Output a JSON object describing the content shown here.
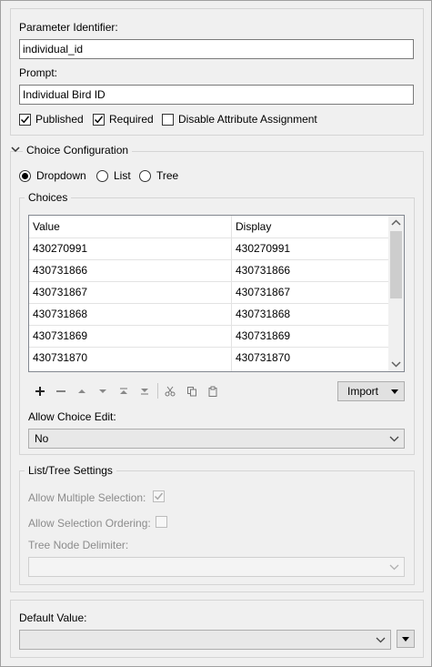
{
  "parameter_identifier": {
    "label": "Parameter Identifier:",
    "value": "individual_id"
  },
  "prompt": {
    "label": "Prompt:",
    "value": "Individual Bird ID"
  },
  "flags": {
    "published": {
      "label": "Published",
      "checked": true
    },
    "required": {
      "label": "Required",
      "checked": true
    },
    "disable_attr": {
      "label": "Disable Attribute Assignment",
      "checked": false
    }
  },
  "choice_config": {
    "title": "Choice Configuration",
    "types": [
      {
        "label": "Dropdown",
        "selected": true
      },
      {
        "label": "List",
        "selected": false
      },
      {
        "label": "Tree",
        "selected": false
      }
    ],
    "choices_title": "Choices",
    "columns": [
      "Value",
      "Display"
    ],
    "rows": [
      [
        "430270991",
        "430270991"
      ],
      [
        "430731866",
        "430731866"
      ],
      [
        "430731867",
        "430731867"
      ],
      [
        "430731868",
        "430731868"
      ],
      [
        "430731869",
        "430731869"
      ],
      [
        "430731870",
        "430731870"
      ]
    ],
    "import_label": "Import",
    "allow_choice_edit_label": "Allow Choice Edit:",
    "allow_choice_edit_value": "No"
  },
  "list_tree": {
    "title": "List/Tree Settings",
    "allow_multiple_label": "Allow Multiple Selection:",
    "allow_multiple_checked": true,
    "allow_ordering_label": "Allow Selection Ordering:",
    "allow_ordering_checked": false,
    "delimiter_label": "Tree Node Delimiter:",
    "delimiter_value": ""
  },
  "default_value": {
    "label": "Default Value:",
    "value": ""
  },
  "icons": {
    "check": "check-icon",
    "chevron": "chevron-down-icon",
    "add": "plus-icon",
    "remove": "minus-icon",
    "move_up": "move-up-icon",
    "move_down": "move-down-icon",
    "move_top": "move-top-icon",
    "move_bottom": "move-bottom-icon",
    "cut": "cut-icon",
    "copy": "copy-icon",
    "paste": "paste-icon"
  }
}
